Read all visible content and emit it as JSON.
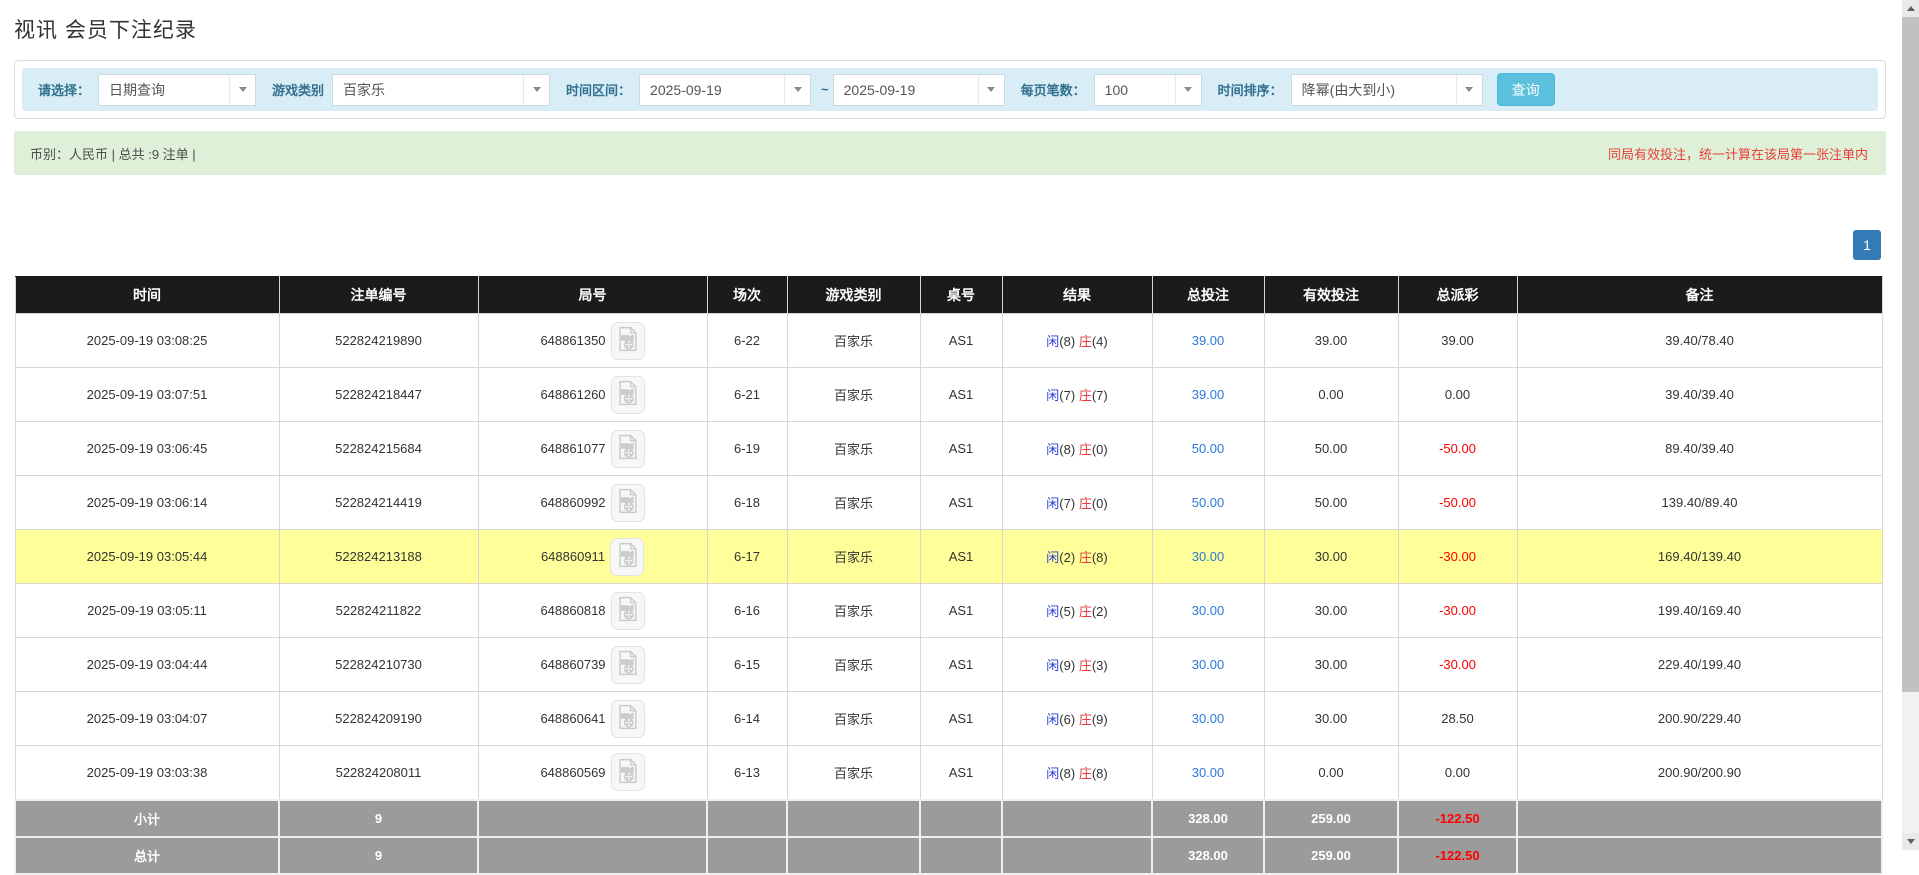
{
  "page": {
    "title": "视讯 会员下注纪录"
  },
  "colors": {
    "accent_blue": "#5bc0de",
    "filter_bg": "#d9edf7",
    "summary_bg": "#dff0d8",
    "header_bg": "#1b1b1b",
    "highlight_row": "#ffff99",
    "footer_bg": "#9b9b9b",
    "link_blue": "#2a79d9",
    "player_blue": "#2a3fd4",
    "banker_red": "#e4393c",
    "negative_red": "#ff0000",
    "pagination_blue": "#337ab7"
  },
  "icons": {
    "dropdown": "chevron-down-icon",
    "round_video": "video-replay-icon",
    "scroll_up": "up-arrow-icon",
    "scroll_down": "down-arrow-icon"
  },
  "filters": {
    "select_label": "请选择：",
    "select_value": "日期查询",
    "game_label": "游戏类别",
    "game_value": "百家乐",
    "range_label": "时间区间：",
    "date_from": "2025-09-19",
    "range_sep": "~",
    "date_to": "2025-09-19",
    "page_size_label": "每页笔数：",
    "page_size_value": "100",
    "sort_label": "时间排序：",
    "sort_value": "降幂(由大到小)",
    "search_button": "查询"
  },
  "summary": {
    "left": "币别：人民币 | 总共 :9 注单 |",
    "right": "同局有效投注，统一计算在该局第一张注单内"
  },
  "pagination": {
    "current": "1"
  },
  "table": {
    "headers": [
      "时间",
      "注单编号",
      "局号",
      "场次",
      "游戏类别",
      "桌号",
      "结果",
      "总投注",
      "有效投注",
      "总派彩",
      "备注"
    ],
    "rows": [
      {
        "time": "2025-09-19 03:08:25",
        "bet_id": "522824219890",
        "round_id": "648861350",
        "session": "6-22",
        "game": "百家乐",
        "table_no": "AS1",
        "player": "闲",
        "player_score": "(8)",
        "banker": "庄",
        "banker_score": "(4)",
        "total_bet": "39.00",
        "valid_bet": "39.00",
        "payout": "39.00",
        "remark": "39.40/78.40",
        "highlight": false
      },
      {
        "time": "2025-09-19 03:07:51",
        "bet_id": "522824218447",
        "round_id": "648861260",
        "session": "6-21",
        "game": "百家乐",
        "table_no": "AS1",
        "player": "闲",
        "player_score": "(7)",
        "banker": "庄",
        "banker_score": "(7)",
        "total_bet": "39.00",
        "valid_bet": "0.00",
        "payout": "0.00",
        "remark": "39.40/39.40",
        "highlight": false
      },
      {
        "time": "2025-09-19 03:06:45",
        "bet_id": "522824215684",
        "round_id": "648861077",
        "session": "6-19",
        "game": "百家乐",
        "table_no": "AS1",
        "player": "闲",
        "player_score": "(8)",
        "banker": "庄",
        "banker_score": "(0)",
        "total_bet": "50.00",
        "valid_bet": "50.00",
        "payout": "-50.00",
        "remark": "89.40/39.40",
        "highlight": false
      },
      {
        "time": "2025-09-19 03:06:14",
        "bet_id": "522824214419",
        "round_id": "648860992",
        "session": "6-18",
        "game": "百家乐",
        "table_no": "AS1",
        "player": "闲",
        "player_score": "(7)",
        "banker": "庄",
        "banker_score": "(0)",
        "total_bet": "50.00",
        "valid_bet": "50.00",
        "payout": "-50.00",
        "remark": "139.40/89.40",
        "highlight": false
      },
      {
        "time": "2025-09-19 03:05:44",
        "bet_id": "522824213188",
        "round_id": "648860911",
        "session": "6-17",
        "game": "百家乐",
        "table_no": "AS1",
        "player": "闲",
        "player_score": "(2)",
        "banker": "庄",
        "banker_score": "(8)",
        "total_bet": "30.00",
        "valid_bet": "30.00",
        "payout": "-30.00",
        "remark": "169.40/139.40",
        "highlight": true
      },
      {
        "time": "2025-09-19 03:05:11",
        "bet_id": "522824211822",
        "round_id": "648860818",
        "session": "6-16",
        "game": "百家乐",
        "table_no": "AS1",
        "player": "闲",
        "player_score": "(5)",
        "banker": "庄",
        "banker_score": "(2)",
        "total_bet": "30.00",
        "valid_bet": "30.00",
        "payout": "-30.00",
        "remark": "199.40/169.40",
        "highlight": false
      },
      {
        "time": "2025-09-19 03:04:44",
        "bet_id": "522824210730",
        "round_id": "648860739",
        "session": "6-15",
        "game": "百家乐",
        "table_no": "AS1",
        "player": "闲",
        "player_score": "(9)",
        "banker": "庄",
        "banker_score": "(3)",
        "total_bet": "30.00",
        "valid_bet": "30.00",
        "payout": "-30.00",
        "remark": "229.40/199.40",
        "highlight": false
      },
      {
        "time": "2025-09-19 03:04:07",
        "bet_id": "522824209190",
        "round_id": "648860641",
        "session": "6-14",
        "game": "百家乐",
        "table_no": "AS1",
        "player": "闲",
        "player_score": "(6)",
        "banker": "庄",
        "banker_score": "(9)",
        "total_bet": "30.00",
        "valid_bet": "30.00",
        "payout": "28.50",
        "remark": "200.90/229.40",
        "highlight": false
      },
      {
        "time": "2025-09-19 03:03:38",
        "bet_id": "522824208011",
        "round_id": "648860569",
        "session": "6-13",
        "game": "百家乐",
        "table_no": "AS1",
        "player": "闲",
        "player_score": "(8)",
        "banker": "庄",
        "banker_score": "(8)",
        "total_bet": "30.00",
        "valid_bet": "0.00",
        "payout": "0.00",
        "remark": "200.90/200.90",
        "highlight": false
      }
    ],
    "footers": [
      {
        "label": "小计",
        "count": "9",
        "total_bet": "328.00",
        "valid_bet": "259.00",
        "payout": "-122.50"
      },
      {
        "label": "总计",
        "count": "9",
        "total_bet": "328.00",
        "valid_bet": "259.00",
        "payout": "-122.50"
      }
    ]
  }
}
